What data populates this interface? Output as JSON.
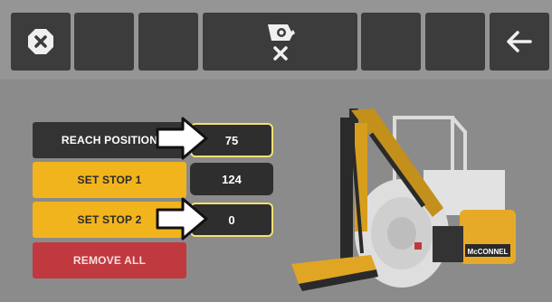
{
  "toolbar": {
    "close_icon": "close-icon",
    "center_icon": "mower-head-cancel-icon",
    "back_icon": "back-arrow-icon"
  },
  "controls": {
    "reach_position_label": "REACH POSITION",
    "reach_position_value": "75",
    "set_stop_1_label": "SET STOP 1",
    "set_stop_1_value": "124",
    "set_stop_2_label": "SET STOP 2",
    "set_stop_2_value": "0",
    "remove_all_label": "REMOVE ALL"
  },
  "machine": {
    "brand_label": "McCONNEL"
  },
  "colors": {
    "accent_yellow": "#f2b41c",
    "danger_red": "#c0393f",
    "selected_outline": "#f4e070"
  }
}
